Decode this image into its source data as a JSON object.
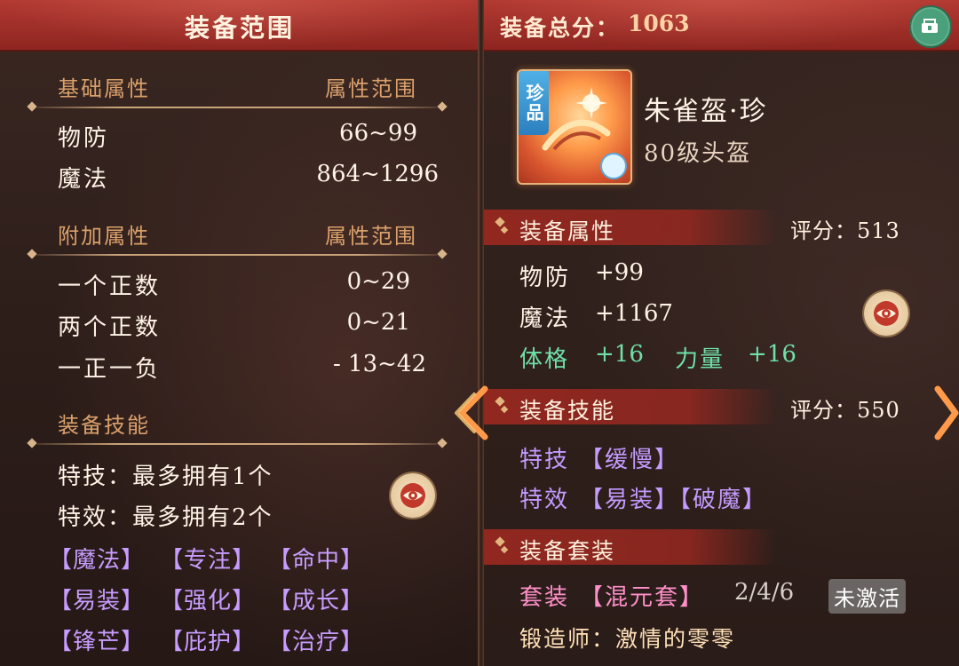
{
  "left": {
    "title": "装备范围",
    "basic": {
      "label": "基础属性",
      "range_label": "属性范围",
      "rows": [
        {
          "name": "物防",
          "value": "66~99"
        },
        {
          "name": "魔法",
          "value": "864~1296"
        }
      ]
    },
    "extra": {
      "label": "附加属性",
      "range_label": "属性范围",
      "rows": [
        {
          "name": "一个正数",
          "value": "0~29"
        },
        {
          "name": "两个正数",
          "value": "0~21"
        },
        {
          "name": "一正一负",
          "value": "- 13~42"
        }
      ]
    },
    "skills": {
      "label": "装备技能",
      "line1": "特技：最多拥有1个",
      "line2": "特效：最多拥有2个",
      "tags": [
        "【魔法】",
        "【专注】",
        "【命中】",
        "【易装】",
        "【强化】",
        "【成长】",
        "【锋芒】",
        "【庇护】",
        "【治疗】"
      ]
    },
    "eye_icon": "eye-icon"
  },
  "right": {
    "total_label": "装备总分：",
    "total_value": "1063",
    "share_icon": "share-icon",
    "item": {
      "quality": "珍品",
      "name": "朱雀盔·珍",
      "subtitle": "80级头盔"
    },
    "attr_section": {
      "title": "装备属性",
      "score": "评分：513",
      "rows": [
        {
          "name": "物防",
          "value": "+99"
        },
        {
          "name": "魔法",
          "value": "+1167"
        }
      ],
      "bonus": [
        {
          "name": "体格",
          "value": "+16"
        },
        {
          "name": "力量",
          "value": "+16"
        }
      ]
    },
    "skill_section": {
      "title": "装备技能",
      "score": "评分：550",
      "line1_prefix": "特技",
      "line1_tags": "【缓慢】",
      "line2_prefix": "特效",
      "line2_tags": "【易装】【破魔】"
    },
    "set_section": {
      "title": "装备套装",
      "set_label": "套装",
      "set_name": "【混元套】",
      "set_count": "2/4/6",
      "set_status": "未激活",
      "smith": "锻造师：激情的零零"
    }
  },
  "colors": {
    "header_red": "#a32c26",
    "section_label": "#d9a06b",
    "purple_tag": "#c39bff",
    "green_stat": "#6fe0a8",
    "pink_set": "#ff8fc9"
  }
}
